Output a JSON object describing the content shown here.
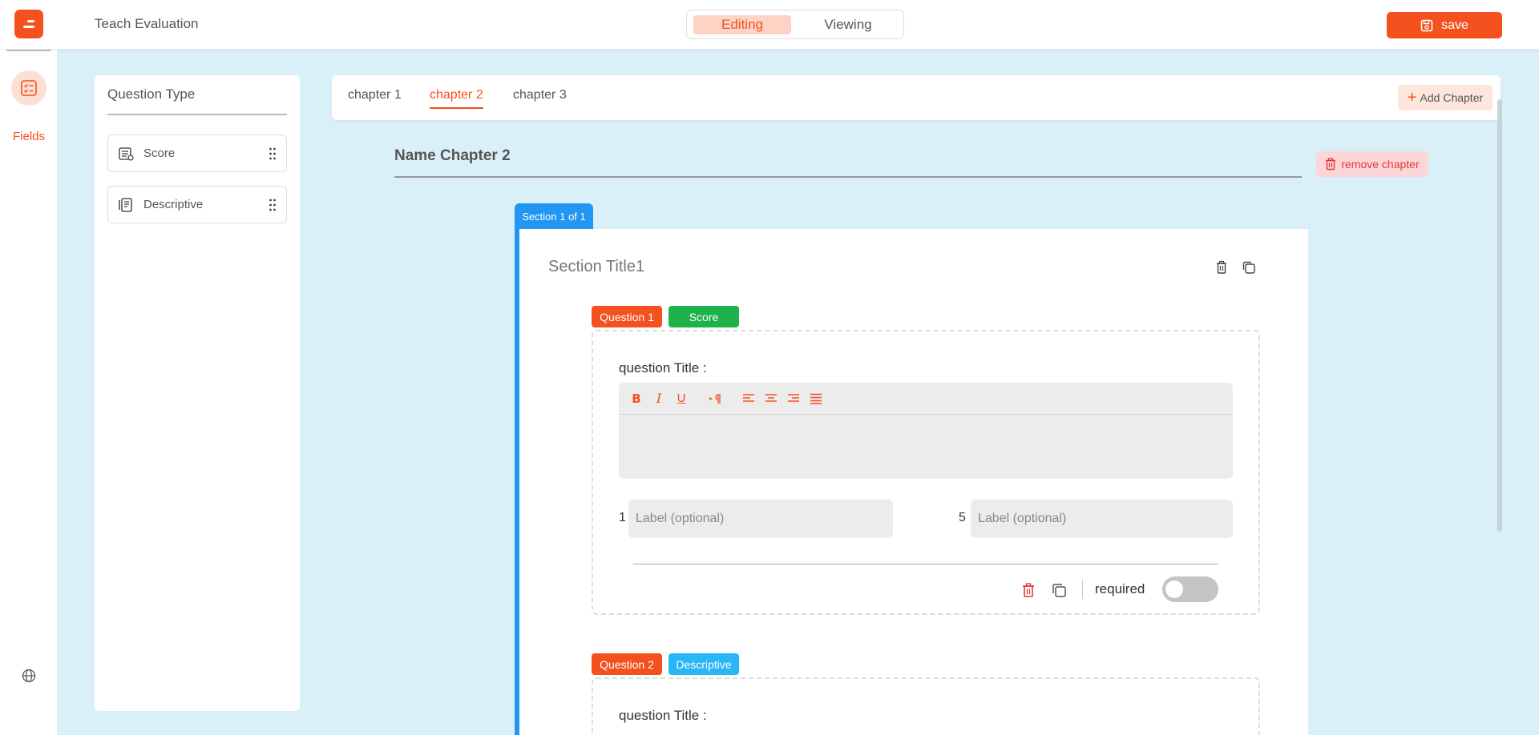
{
  "header": {
    "app_title": "Teach Evaluation",
    "mode_editing": "Editing",
    "mode_viewing": "Viewing",
    "save_label": "save"
  },
  "rail": {
    "fields_label": "Fields"
  },
  "question_type": {
    "title": "Question Type",
    "items": [
      {
        "label": "Score",
        "icon": "score-icon"
      },
      {
        "label": "Descriptive",
        "icon": "descriptive-icon"
      }
    ]
  },
  "chapters": {
    "tabs": [
      "chapter 1",
      "chapter 2",
      "chapter 3"
    ],
    "active_index": 1,
    "add_label": "Add Chapter",
    "name": "Name Chapter 2",
    "remove_label": "remove chapter"
  },
  "section": {
    "tab_label": "Section 1 of 1",
    "title": "Section Title1"
  },
  "questions": [
    {
      "badge": "Question 1",
      "type_badge": "Score",
      "title_label": "question Title :",
      "scale_min": "1",
      "scale_max": "5",
      "label_placeholder": "Label (optional)",
      "required_label": "required",
      "required": false
    },
    {
      "badge": "Question 2",
      "type_badge": "Descriptive",
      "title_label": "question Title :"
    }
  ],
  "colors": {
    "accent": "#f4511e",
    "section_blue": "#2196f3",
    "score_green": "#1db34a",
    "descriptive_blue": "#29b6f6",
    "background": "#daf0f8"
  }
}
